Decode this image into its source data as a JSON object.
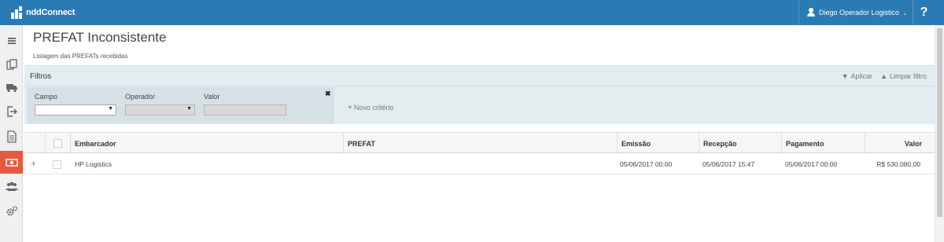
{
  "app": {
    "logo_text": "nddConnect"
  },
  "header": {
    "user_name": "Diego Operador Logistico",
    "help_label": "?"
  },
  "colors": {
    "topbar": "#2a7ab4",
    "active_sidebar": "#e45a3f",
    "filter_bg": "#e3edf0"
  },
  "sidebar": {
    "items": [
      {
        "icon": "menu-icon",
        "active": false
      },
      {
        "icon": "documents-icon",
        "active": false
      },
      {
        "icon": "truck-icon",
        "active": false
      },
      {
        "icon": "export-icon",
        "active": false
      },
      {
        "icon": "file-icon",
        "active": false
      },
      {
        "icon": "money-icon",
        "active": true
      },
      {
        "icon": "users-icon",
        "active": false
      },
      {
        "icon": "settings-icon",
        "active": false
      }
    ]
  },
  "page": {
    "title": "PREFAT Inconsistente",
    "subtitle": "Listagem das PREFATs recebidas"
  },
  "filters": {
    "title": "Filtros",
    "apply_label": "Aplicar",
    "clear_label": "Limpar filtro",
    "field_label": "Campo",
    "operator_label": "Operador",
    "value_label": "Valor",
    "close_glyph": "✖",
    "new_criteria_label": "Novo critério"
  },
  "grid": {
    "columns": [
      "Embarcador",
      "PREFAT",
      "Emissão",
      "Recepção",
      "Pagamento",
      "Valor"
    ],
    "rows": [
      {
        "expand": "+",
        "embarcador": "HP Logistics",
        "prefat": "",
        "emissao": "05/06/2017 00:00",
        "recepcao": "05/06/2017 15:47",
        "pagamento": "05/06/2017 00:00",
        "valor": "R$ 530.080,00"
      }
    ]
  }
}
